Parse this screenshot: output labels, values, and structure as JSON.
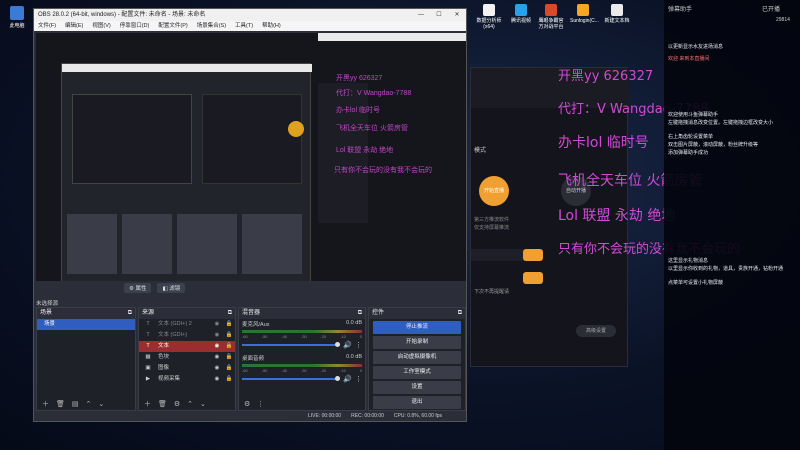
{
  "desktop": {
    "icon_pc": "此电脑",
    "top_icons": [
      "数据分析师(x64)",
      "腾讯视频",
      "鹰眼争霸官方对战平台",
      "Sunlogin(C...",
      "新建文本档"
    ]
  },
  "obs": {
    "title": "OBS 28.0.2 (64-bit, windows) - 配置文件: 未命名 - 场景: 未命名",
    "min": "—",
    "max": "☐",
    "close": "✕",
    "menu": [
      "文件(F)",
      "编辑(E)",
      "视图(V)",
      "停靠窗口(D)",
      "配置文件(P)",
      "场景集合(S)",
      "工具(T)",
      "帮助(H)"
    ],
    "scenebar": {
      "properties": "属性",
      "filters": "滤镜"
    },
    "no_source": "未选择源",
    "scenes": {
      "title": "场景",
      "items": [
        "场景"
      ]
    },
    "sources": {
      "title": "来源",
      "items": [
        "文本 (GDI+) 2",
        "文本 (GDI+)",
        "文本",
        "色块",
        "图像",
        "视频采集"
      ]
    },
    "mixer": {
      "title": "混音器",
      "channels": [
        {
          "name": "麦克风/Aux",
          "db": "0.0 dB"
        },
        {
          "name": "桌面音频",
          "db": "0.0 dB"
        }
      ],
      "scale": [
        "-60",
        "-55",
        "-50",
        "-45",
        "-40",
        "-35",
        "-30",
        "-25",
        "-20",
        "-15",
        "-10",
        "-5",
        "0"
      ]
    },
    "controls": {
      "title": "控件",
      "buttons": [
        "停止推流",
        "开始录制",
        "启动虚拟摄像机",
        "工作室模式",
        "设置",
        "退出"
      ]
    },
    "status": {
      "live": "LIVE: 00:00:00",
      "rec": "REC: 00:00:00",
      "cpu": "CPU: 0.8%, 60.00 fps"
    }
  },
  "assistant": {
    "mode": "模式",
    "start_live": "开始直播",
    "live_done": "自动开播",
    "note1": "第三方推流软件",
    "note2": "仅支持屏幕推流",
    "hint": "下次不再提醒请",
    "ribbon": "高级设置"
  },
  "overlay": {
    "line1": "开黑yy   626327",
    "line2": "代打：V Wangdao-7788",
    "line3": "办卡lol   临时号",
    "line4": "飞机全天车位  火箭房管",
    "line5": "Lol  联盟   永劫   绝地",
    "line6": "只有你不会玩的没有我不会玩的"
  },
  "chat": {
    "header": "弹幕助手",
    "online": "已开播",
    "count": "29814",
    "lines": [
      "以更新显示水友进场消息",
      "欢迎 来到本直播间",
      "欢迎使用斗鱼弹幕助手",
      "左键拖拽消息改变位置。左键拖拽边框改变大小",
      "右上角齿轮设置菜单",
      "双击图片屏蔽，滚动屏蔽，粉丝牌升级等",
      "添加弹幕助手成功",
      "这里显示礼物消息",
      "以里显示你收到的礼物，道具，贵族开通，钻粉开通",
      "点菜单可设置小礼物屏蔽"
    ]
  },
  "colors": {
    "accent": "#2f5dc0",
    "overlay": "#d04ad6",
    "stop": "#9a2d2d",
    "orange": "#f0a030"
  }
}
